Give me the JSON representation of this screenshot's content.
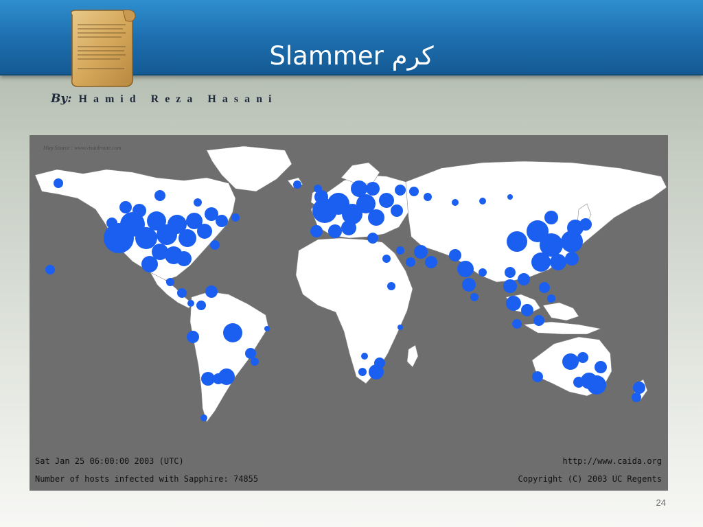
{
  "slide": {
    "title": "Slammer کرم",
    "byline_label": "By:",
    "author": "Hamid Reza Hasani",
    "page_number": "24"
  },
  "map": {
    "source": "Map Source : www.visualroute.com",
    "timestamp": "Sat Jan 25 06:00:00 2003 (UTC)",
    "url": "http://www.caida.org",
    "infected_label": "Number of hosts infected with Sapphire: 74855",
    "copyright": "Copyright (C) 2003 UC Regents",
    "colors": {
      "ocean": "#6e6e6e",
      "land": "#ffffff",
      "infection": "#1a5ff0"
    }
  }
}
